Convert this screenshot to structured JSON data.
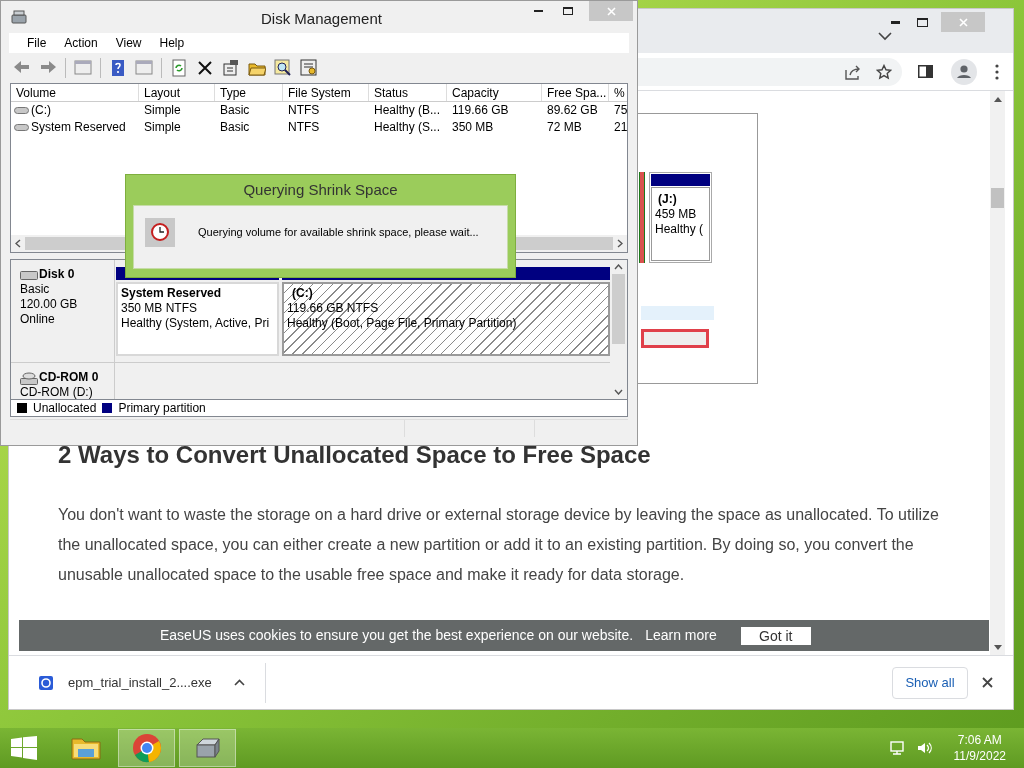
{
  "browser": {
    "article": {
      "image": {
        "partition": {
          "label": "(J:)",
          "size": "459 MB",
          "status": "Healthy ("
        }
      },
      "heading": "2 Ways to Convert Unallocated Space to Free Space",
      "paragraph": "You don't want to waste the storage on a hard drive or external storage device by leaving the space as unallocated. To utilize the unallocated space, you can either create a new partition or add it to an existing partition. By doing so, you convert the unusable unallocated space to the usable free space and make it ready for data storage."
    },
    "cookie_banner": {
      "message": "EaseUS uses cookies to ensure you get the best experience on our website.",
      "link": "Learn more",
      "button": "Got it"
    },
    "download_bar": {
      "file": "epm_trial_install_2....exe",
      "show_all": "Show all"
    }
  },
  "disk_management": {
    "title": "Disk Management",
    "menu": [
      "File",
      "Action",
      "View",
      "Help"
    ],
    "columns": [
      "Volume",
      "Layout",
      "Type",
      "File System",
      "Status",
      "Capacity",
      "Free Spa...",
      "%"
    ],
    "rows": [
      {
        "cells": [
          "(C:)",
          "Simple",
          "Basic",
          "NTFS",
          "Healthy (B...",
          "119.66 GB",
          "89.62 GB",
          "75"
        ]
      },
      {
        "cells": [
          "System Reserved",
          "Simple",
          "Basic",
          "NTFS",
          "Healthy (S...",
          "350 MB",
          "72 MB",
          "21"
        ]
      }
    ],
    "disks": [
      {
        "kind": "disk",
        "name": "Disk 0",
        "details": [
          "Basic",
          "120.00 GB",
          "Online"
        ],
        "partitions": [
          {
            "name": "System Reserved",
            "size": "350 MB NTFS",
            "status": "Healthy (System, Active, Pri",
            "selected": false
          },
          {
            "name": "(C:)",
            "size": "119.66 GB NTFS",
            "status": "Healthy (Boot, Page File, Primary Partition)",
            "selected": true
          }
        ]
      },
      {
        "kind": "cdrom",
        "name": "CD-ROM 0",
        "details": [
          "CD-ROM (D:)"
        ]
      }
    ],
    "legend": [
      {
        "label": "Unallocated",
        "color": "#000000"
      },
      {
        "label": "Primary partition",
        "color": "#000080"
      }
    ]
  },
  "dialog": {
    "title": "Querying Shrink Space",
    "message": "Querying volume for available shrink space, please wait..."
  },
  "taskbar": {
    "apps": [
      {
        "kind": "explorer",
        "open": false
      },
      {
        "kind": "chrome",
        "open": true
      },
      {
        "kind": "disk",
        "open": true
      }
    ],
    "time": "7:06 AM",
    "date": "11/9/2022"
  }
}
